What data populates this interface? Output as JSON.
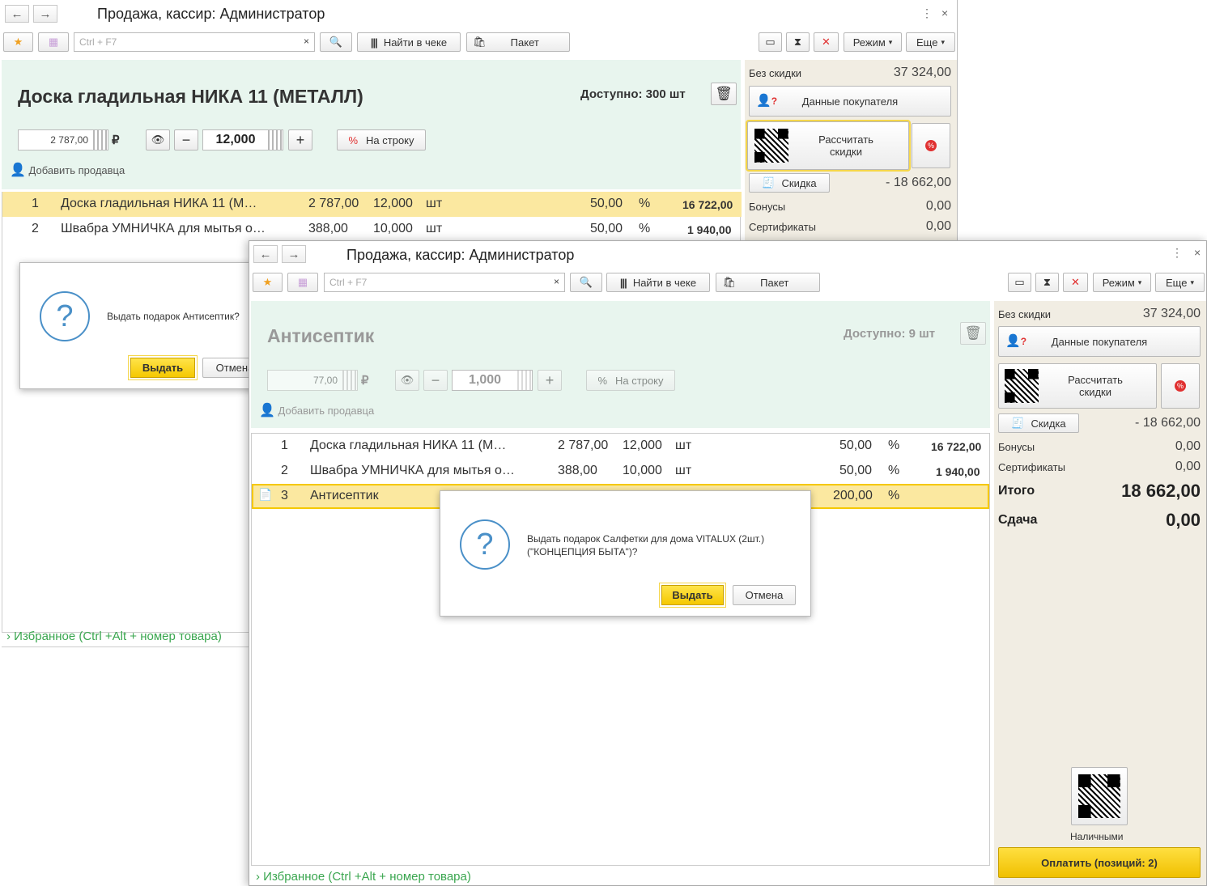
{
  "window_title": "Продажа, кассир: Администратор",
  "toolbar": {
    "search_placeholder": "Ctrl + F7",
    "search_clear": "×",
    "find_in_receipt": "Найти в чеке",
    "package": "Пакет",
    "mode": "Режим",
    "more": "Еще"
  },
  "w1": {
    "product_name": "Доска гладильная  НИКА 11 (МЕТАЛЛ)",
    "available": "Доступно: 300 шт",
    "price": "2 787,00",
    "currency": "₽",
    "qty": "12,000",
    "per_line": "На строку",
    "add_seller": "Добавить продавца",
    "rows": [
      {
        "n": "1",
        "name": "Доска гладильная  НИКА 11 (М…",
        "price": "2 787,00",
        "qty": "12,000",
        "unit": "шт",
        "disc": "50,00",
        "pct": "%",
        "sum": "16 722,00"
      },
      {
        "n": "2",
        "name": "Швабра УМНИЧКА для мытья о…",
        "price": "388,00",
        "qty": "10,000",
        "unit": "шт",
        "disc": "50,00",
        "pct": "%",
        "sum": "1 940,00"
      }
    ],
    "dialog_text": "Выдать подарок Антисептик?",
    "dialog_ok": "Выдать",
    "dialog_cancel": "Отмена",
    "favorites": "Избранное (Ctrl +Alt + номер товара)"
  },
  "right": {
    "no_discount_label": "Без скидки",
    "no_discount_value": "37 324,00",
    "buyer_data": "Данные покупателя",
    "calc_discounts": "Рассчитать скидки",
    "discount": "Скидка",
    "discount_value": "- 18 662,00",
    "bonuses": "Бонусы",
    "bonuses_value": "0,00",
    "certificates": "Сертификаты",
    "certificates_value": "0,00",
    "total_label": "Итого",
    "total_value": "18 662,00",
    "change_label": "Сдача",
    "change_value": "0,00",
    "cash": "Наличными",
    "pay": "Оплатить (позиций: 2)"
  },
  "w2": {
    "product_name": "Антисептик",
    "available": "Доступно: 9 шт",
    "price": "77,00",
    "currency": "₽",
    "qty": "1,000",
    "per_line": "На строку",
    "add_seller": "Добавить продавца",
    "rows": [
      {
        "n": "1",
        "name": "Доска гладильная  НИКА 11 (М…",
        "price": "2 787,00",
        "qty": "12,000",
        "unit": "шт",
        "disc": "50,00",
        "pct": "%",
        "sum": "16 722,00"
      },
      {
        "n": "2",
        "name": "Швабра УМНИЧКА для мытья о…",
        "price": "388,00",
        "qty": "10,000",
        "unit": "шт",
        "disc": "50,00",
        "pct": "%",
        "sum": "1 940,00"
      },
      {
        "n": "3",
        "name": "Антисептик",
        "price": "",
        "qty": "",
        "unit": "",
        "disc": "200,00",
        "pct": "%",
        "sum": ""
      }
    ],
    "dialog_text_1": "Выдать подарок Салфетки для дома VITALUX (2шт.)",
    "dialog_text_2": "(\"КОНЦЕПЦИЯ БЫТА\")?",
    "dialog_ok": "Выдать",
    "dialog_cancel": "Отмена",
    "favorites": "Избранное (Ctrl +Alt + номер товара)"
  },
  "colors": {
    "accent_yellow": "#f5c800",
    "product_bg": "#e8f5ee",
    "favorites_green": "#3aa64f",
    "selected_row": "#fbe8a0"
  }
}
